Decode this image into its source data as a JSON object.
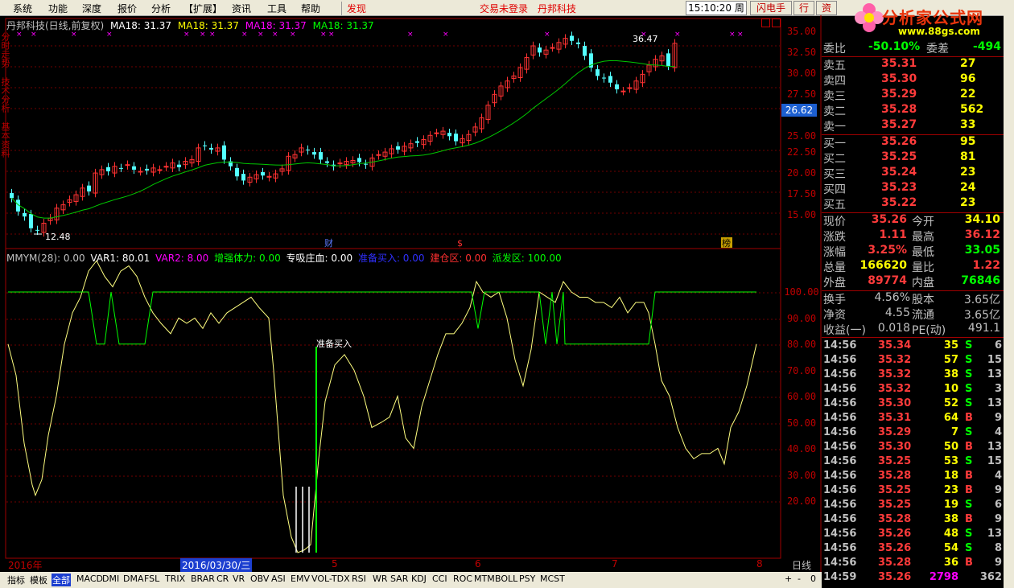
{
  "menu": {
    "items": [
      "系统",
      "功能",
      "深度",
      "报价",
      "分析",
      "【扩展】",
      "资讯",
      "工具",
      "帮助"
    ],
    "find": "发现",
    "status": "交易未登录",
    "company": "丹邦科技",
    "clock": "15:10:20 周一",
    "flash_button": "闪电手",
    "trade_button": "行",
    "extra_button": "资"
  },
  "logo": {
    "title": "分析家公式网",
    "url": "www.88gs.com"
  },
  "chart": {
    "stock_title": "丹邦科技(日线,前复权)",
    "ma_labels": [
      "MA18: 31.37",
      "MA18: 31.37",
      "MA18: 31.37",
      "MA18: 31.37"
    ],
    "ma_colors": [
      "#ffffff",
      "#ffff00",
      "#ff00ff",
      "#00ff00"
    ],
    "price_axis": [
      "35.00",
      "32.50",
      "30.00",
      "27.50",
      "25.00",
      "22.50",
      "20.00",
      "17.50",
      "15.00"
    ],
    "current_price_tag": "26.62",
    "max_label": "36.47",
    "min_label": "12.48",
    "markers": [
      "财",
      "$",
      "榜"
    ],
    "ma_color": "#00c800",
    "up_color": "#ff3232",
    "down_color": "#54ffff"
  },
  "indicator": {
    "name": "MMYM(28)",
    "name_value": ": 0.00",
    "vars": [
      {
        "label": "VAR1: 80.01",
        "color": "#ffffff"
      },
      {
        "label": "VAR2: 8.00",
        "color": "#ff00ff"
      },
      {
        "label": "增强体力: 0.00",
        "color": "#00ff00"
      },
      {
        "label": "专吸庄血: 0.00",
        "color": "#ffffff"
      },
      {
        "label": "准备买入: 0.00",
        "color": "#3030ff"
      },
      {
        "label": "建仓区: 0.00",
        "color": "#ff3030"
      },
      {
        "label": "派发区: 100.00",
        "color": "#00ff00"
      }
    ],
    "axis": [
      "100.00",
      "90.00",
      "80.00",
      "70.00",
      "60.00",
      "50.00",
      "40.00",
      "30.00",
      "20.00"
    ],
    "signal_label": "准备买入"
  },
  "datebar": {
    "year": "2016年",
    "cursor_date": "2016/03/30/三",
    "months": [
      "5",
      "6",
      "7",
      "8"
    ],
    "period": "日线"
  },
  "bottom_tabs": [
    "指标",
    "模板",
    "全部",
    "MACD",
    "DMI",
    "DMA",
    "FSL",
    "TRIX",
    "BRAR",
    "CR",
    "VR",
    "OBV",
    "ASI",
    "EMV",
    "VOL-TDX",
    "RSI",
    "WR",
    "SAR",
    "KDJ",
    "CCI",
    "ROC",
    "MTM",
    "BOLL",
    "PSY",
    "MCST"
  ],
  "bottom_tabs_right": [
    "+",
    "-",
    "0"
  ],
  "left_vertical_tabs": [
    "分时走势",
    "技术分析",
    "基本资料"
  ],
  "quote": {
    "ratio_label": "委比",
    "ratio_value": "-50.10%",
    "diff_label": "委差",
    "diff_value": "-494",
    "asks": [
      {
        "label": "卖五",
        "price": "35.31",
        "vol": "27"
      },
      {
        "label": "卖四",
        "price": "35.30",
        "vol": "96"
      },
      {
        "label": "卖三",
        "price": "35.29",
        "vol": "22"
      },
      {
        "label": "卖二",
        "price": "35.28",
        "vol": "562"
      },
      {
        "label": "卖一",
        "price": "35.27",
        "vol": "33"
      }
    ],
    "bids": [
      {
        "label": "买一",
        "price": "35.26",
        "vol": "95"
      },
      {
        "label": "买二",
        "price": "35.25",
        "vol": "81"
      },
      {
        "label": "买三",
        "price": "35.24",
        "vol": "23"
      },
      {
        "label": "买四",
        "price": "35.23",
        "vol": "24"
      },
      {
        "label": "买五",
        "price": "35.22",
        "vol": "23"
      }
    ],
    "stats": [
      {
        "l1": "现价",
        "v1": "35.26",
        "c1": "#ff3b3b",
        "l2": "今开",
        "v2": "34.10",
        "c2": "#ffff00"
      },
      {
        "l1": "涨跌",
        "v1": "1.11",
        "c1": "#ff3b3b",
        "l2": "最高",
        "v2": "36.12",
        "c2": "#ff3b3b"
      },
      {
        "l1": "涨幅",
        "v1": "3.25%",
        "c1": "#ff3b3b",
        "l2": "最低",
        "v2": "33.05",
        "c2": "#00ff00"
      },
      {
        "l1": "总量",
        "v1": "166620",
        "c1": "#ffff00",
        "l2": "量比",
        "v2": "1.22",
        "c2": "#ff3b3b"
      },
      {
        "l1": "外盘",
        "v1": "89774",
        "c1": "#ff3b3b",
        "l2": "内盘",
        "v2": "76846",
        "c2": "#00ff00"
      }
    ],
    "stats2": [
      {
        "l1": "换手",
        "v1": "4.56%",
        "l2": "股本",
        "v2": "3.65亿"
      },
      {
        "l1": "净资",
        "v1": "4.55",
        "l2": "流通",
        "v2": "3.65亿"
      },
      {
        "l1": "收益(一)",
        "v1": "0.018",
        "l2": "PE(动)",
        "v2": "491.1"
      }
    ],
    "ticks": [
      {
        "t": "14:56",
        "p": "35.34",
        "v": "35",
        "s": "S",
        "n": "6"
      },
      {
        "t": "14:56",
        "p": "35.32",
        "v": "57",
        "s": "S",
        "n": "15"
      },
      {
        "t": "14:56",
        "p": "35.32",
        "v": "38",
        "s": "S",
        "n": "13"
      },
      {
        "t": "14:56",
        "p": "35.32",
        "v": "10",
        "s": "S",
        "n": "3"
      },
      {
        "t": "14:56",
        "p": "35.30",
        "v": "52",
        "s": "S",
        "n": "13"
      },
      {
        "t": "14:56",
        "p": "35.31",
        "v": "64",
        "s": "B",
        "n": "9"
      },
      {
        "t": "14:56",
        "p": "35.29",
        "v": "7",
        "s": "S",
        "n": "4"
      },
      {
        "t": "14:56",
        "p": "35.30",
        "v": "50",
        "s": "B",
        "n": "13"
      },
      {
        "t": "14:56",
        "p": "35.25",
        "v": "53",
        "s": "S",
        "n": "15"
      },
      {
        "t": "14:56",
        "p": "35.28",
        "v": "18",
        "s": "B",
        "n": "4"
      },
      {
        "t": "14:56",
        "p": "35.25",
        "v": "23",
        "s": "B",
        "n": "9"
      },
      {
        "t": "14:56",
        "p": "35.25",
        "v": "19",
        "s": "S",
        "n": "6"
      },
      {
        "t": "14:56",
        "p": "35.28",
        "v": "38",
        "s": "B",
        "n": "9"
      },
      {
        "t": "14:56",
        "p": "35.26",
        "v": "48",
        "s": "S",
        "n": "13"
      },
      {
        "t": "14:56",
        "p": "35.26",
        "v": "54",
        "s": "S",
        "n": "8"
      },
      {
        "t": "14:56",
        "p": "35.28",
        "v": "36",
        "s": "B",
        "n": "9"
      },
      {
        "t": "14:59",
        "p": "35.26",
        "v": "2798",
        "s": "",
        "n": "362"
      }
    ]
  }
}
